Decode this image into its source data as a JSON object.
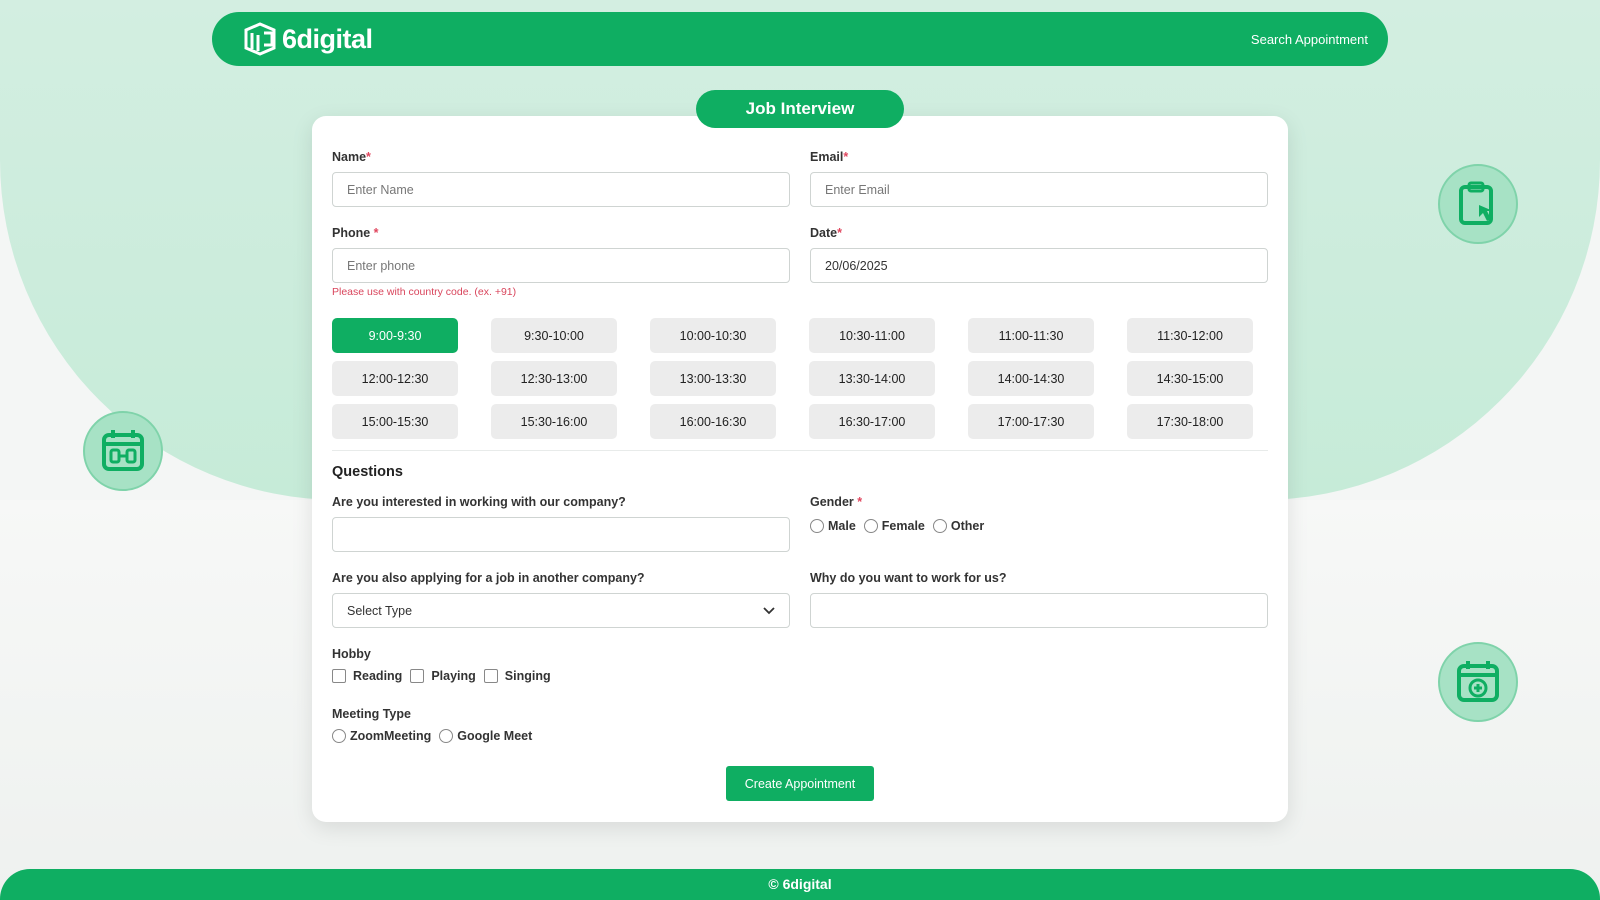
{
  "brand": {
    "name": "6digital",
    "nav_link": "Search Appointment",
    "footer": "© 6digital"
  },
  "colors": {
    "accent": "#0fae62",
    "required": "#e0465e",
    "slot_bg": "#ececec"
  },
  "form": {
    "title": "Job Interview",
    "name": {
      "label": "Name",
      "placeholder": "Enter Name",
      "value": ""
    },
    "email": {
      "label": "Email",
      "placeholder": "Enter Email",
      "value": ""
    },
    "phone": {
      "label": "Phone ",
      "placeholder": "Enter phone",
      "value": "",
      "hint": "Please use with country code. (ex. +91)"
    },
    "date": {
      "label": "Date",
      "value": "20/06/2025"
    },
    "required_mark": "*",
    "time_slots": [
      "9:00-9:30",
      "9:30-10:00",
      "10:00-10:30",
      "10:30-11:00",
      "11:00-11:30",
      "11:30-12:00",
      "12:00-12:30",
      "12:30-13:00",
      "13:00-13:30",
      "13:30-14:00",
      "14:00-14:30",
      "14:30-15:00",
      "15:00-15:30",
      "15:30-16:00",
      "16:00-16:30",
      "16:30-17:00",
      "17:00-17:30",
      "17:30-18:00"
    ],
    "selected_slot": "9:00-9:30",
    "questions_title": "Questions",
    "q_interested": {
      "label": "Are you interested in working with our company?",
      "value": ""
    },
    "gender": {
      "label": "Gender ",
      "options": [
        "Male",
        "Female",
        "Other"
      ],
      "selected": null
    },
    "q_other_company": {
      "label": "Are you also applying for a job in another company?",
      "selected": "Select Type"
    },
    "q_why": {
      "label": "Why do you want to work for us?",
      "value": ""
    },
    "hobby": {
      "label": "Hobby",
      "options": [
        "Reading",
        "Playing",
        "Singing"
      ],
      "checked": []
    },
    "meeting_type": {
      "label": "Meeting Type",
      "options": [
        "ZoomMeeting",
        "Google Meet"
      ],
      "selected": null
    },
    "submit_label": "Create Appointment"
  },
  "icons": {
    "left_badge": "calendar-range-icon",
    "right_top_badge": "clipboard-touch-icon",
    "right_bottom_badge": "calendar-add-icon",
    "dropdown": "chevron-down-icon"
  }
}
